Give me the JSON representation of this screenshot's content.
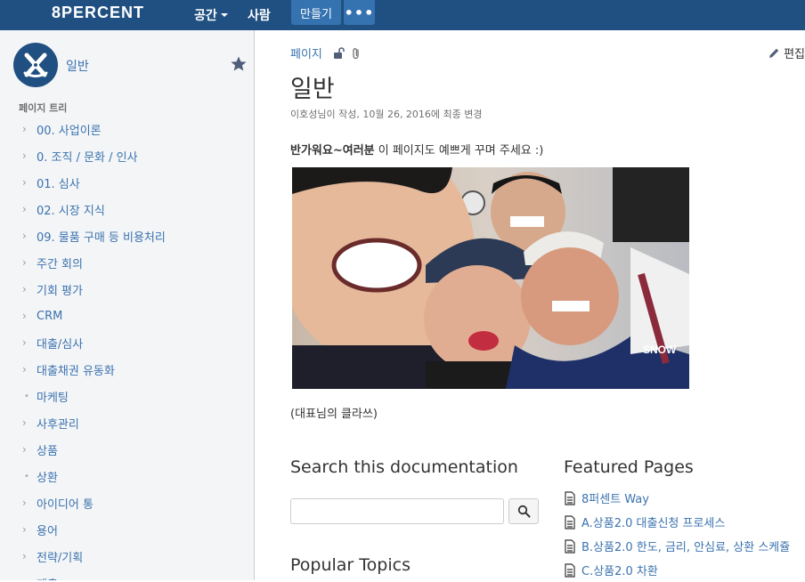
{
  "header": {
    "logo": "8PERCENT",
    "nav_spaces": "공간",
    "nav_people": "사람",
    "create": "만들기",
    "more": "•••"
  },
  "sidebar": {
    "space_name": "일반",
    "tree_title": "페이지 트리",
    "items": [
      {
        "label": "00. 사업이론",
        "type": "chevron"
      },
      {
        "label": "0. 조직 / 문화 / 인사",
        "type": "chevron"
      },
      {
        "label": "01. 심사",
        "type": "chevron"
      },
      {
        "label": "02. 시장 지식",
        "type": "chevron"
      },
      {
        "label": "09. 물품 구매 등 비용처리",
        "type": "chevron"
      },
      {
        "label": "주간 회의",
        "type": "chevron"
      },
      {
        "label": "기회 평가",
        "type": "chevron"
      },
      {
        "label": "CRM",
        "type": "chevron"
      },
      {
        "label": "대출/심사",
        "type": "chevron"
      },
      {
        "label": "대출채권 유동화",
        "type": "chevron"
      },
      {
        "label": "마케팅",
        "type": "dot"
      },
      {
        "label": "사후관리",
        "type": "chevron"
      },
      {
        "label": "상품",
        "type": "chevron"
      },
      {
        "label": "상환",
        "type": "dot"
      },
      {
        "label": "아이디어 통",
        "type": "chevron"
      },
      {
        "label": "용어",
        "type": "chevron"
      },
      {
        "label": "전략/기획",
        "type": "chevron"
      },
      {
        "label": "제출",
        "type": "chevron"
      }
    ]
  },
  "main": {
    "breadcrumb": "페이지",
    "edit": "편집",
    "title": "일반",
    "byline": "이호성님이 작성, 10월 26, 2016에 최종 변경",
    "intro_bold": "반가워요~여러분",
    "intro_rest": " 이 페이지도 예쁘게 꾸며 주세요 :)",
    "photo_watermark": "SNOW",
    "caption": "(대표님의 클라쓰)",
    "search_heading": "Search this documentation",
    "search_placeholder": "",
    "popular_heading": "Popular Topics",
    "featured_heading": "Featured Pages",
    "featured": [
      "8퍼센트 Way",
      "A.상품2.0 대출신청 프로세스",
      "B.상품2.0 한도, 금리, 안심료, 상환 스케쥴",
      "C.상품2.0 차환"
    ]
  },
  "colors": {
    "header_bg": "#205081",
    "button_bg": "#3572b0",
    "link": "#3b73af",
    "sidebar_bg": "#f4f5f7"
  }
}
